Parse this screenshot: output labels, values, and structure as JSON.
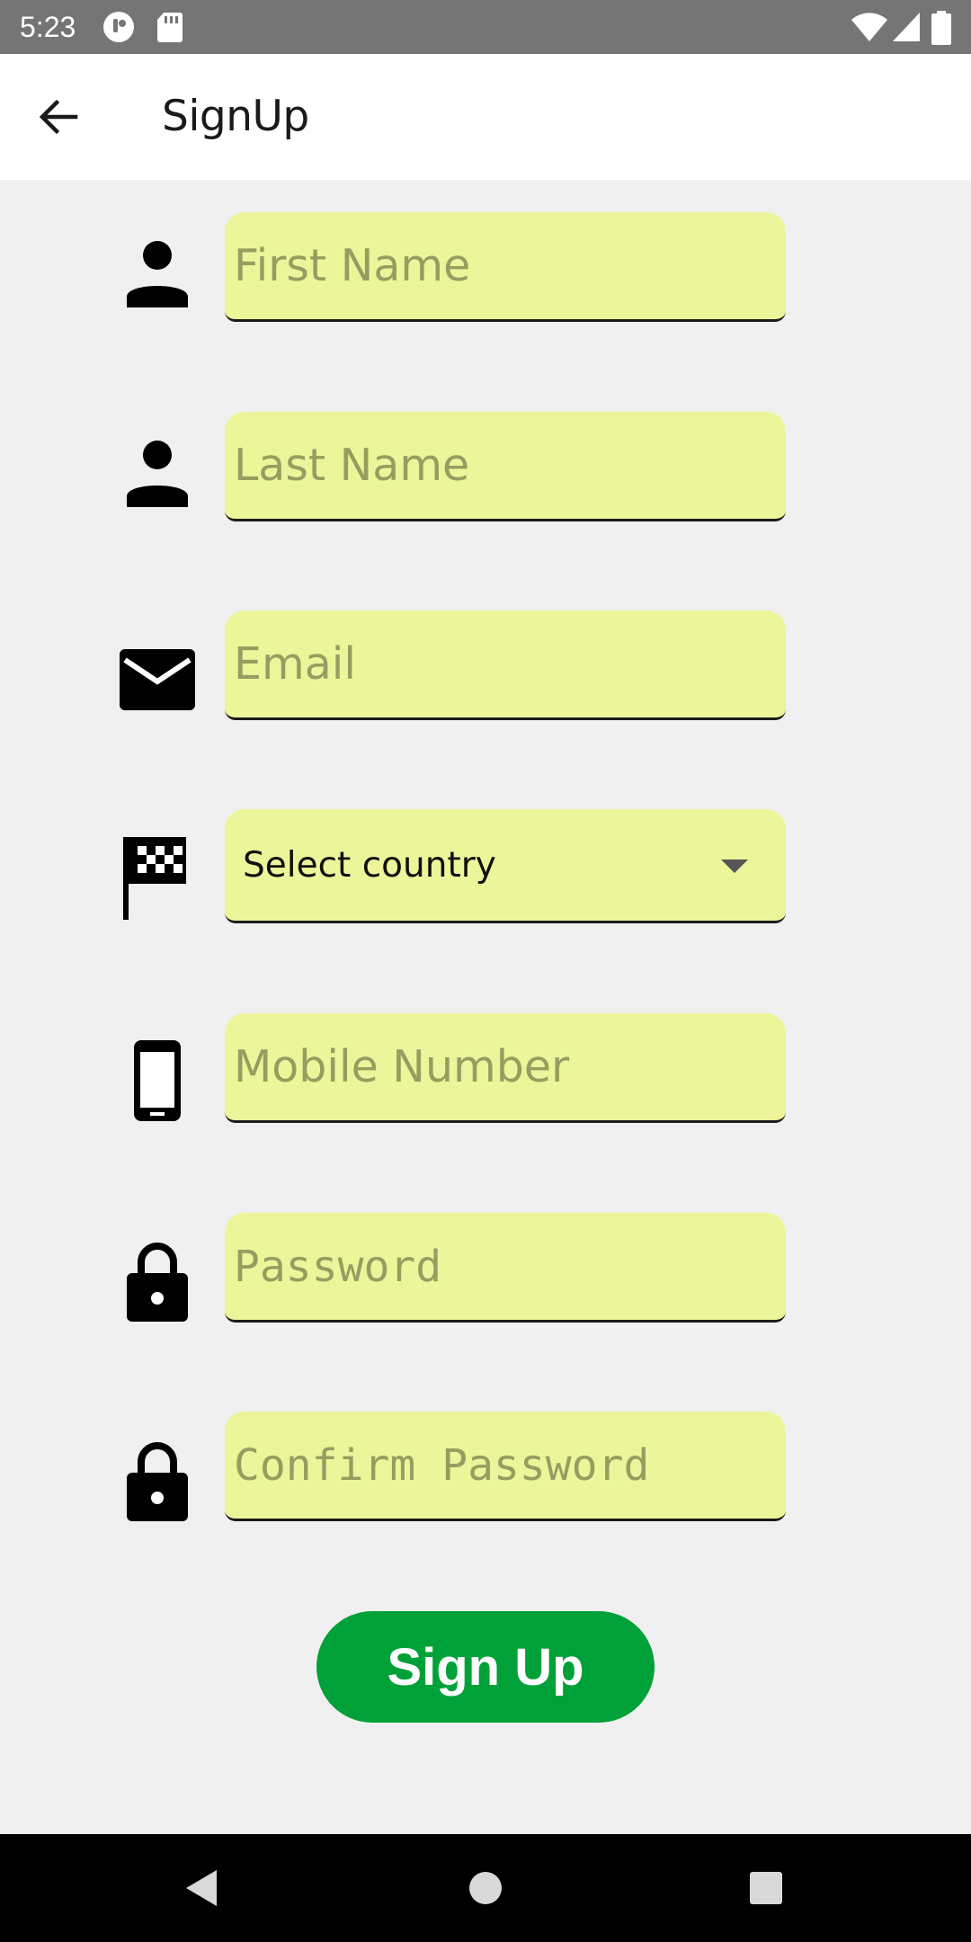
{
  "status_bar": {
    "time": "5:23"
  },
  "app_bar": {
    "title": "SignUp"
  },
  "form": {
    "first_name": {
      "placeholder": "First Name",
      "value": ""
    },
    "last_name": {
      "placeholder": "Last Name",
      "value": ""
    },
    "email": {
      "placeholder": "Email",
      "value": ""
    },
    "country": {
      "selected": "Select country"
    },
    "mobile": {
      "placeholder": "Mobile Number",
      "value": ""
    },
    "password": {
      "placeholder": "Password",
      "value": ""
    },
    "confirm_password": {
      "placeholder": "Confirm Password",
      "value": ""
    }
  },
  "actions": {
    "signup_label": "Sign Up"
  },
  "icons": {
    "first_name": "person-icon",
    "last_name": "person-icon",
    "email": "mail-icon",
    "country": "checkered-flag-icon",
    "mobile": "phone-icon",
    "password": "lock-icon",
    "confirm_password": "lock-icon"
  },
  "colors": {
    "field_background": "#ecf59a",
    "button": "#00a138",
    "status_bar": "#757575",
    "nav_bar": "#000000"
  }
}
